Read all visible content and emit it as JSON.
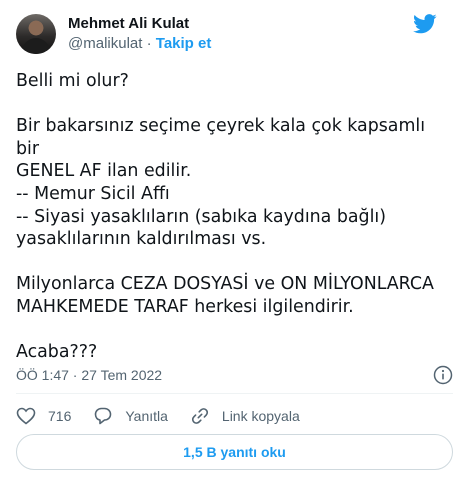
{
  "author": {
    "name": "Mehmet Ali Kulat",
    "handle": "@malikulat",
    "separator": "·",
    "follow_label": "Takip et"
  },
  "tweet": {
    "line1": "Belli mi olur?",
    "para2": "Bir bakarsınız seçime çeyrek kala çok kapsamlı bir\nGENEL AF ilan edilir.\n-- Memur Sicil Affı\n-- Siyasi yasaklıların (sabıka kaydına bağlı)\nyasaklılarının kaldırılması vs.",
    "para3": "Milyonlarca CEZA DOSYASİ ve ON MİLYONLARCA\nMAHKEMEDE TARAF herkesi ilgilendirir.",
    "para4": "Acaba???"
  },
  "meta": {
    "timestamp": "ÖÖ 1:47 · 27 Tem 2022"
  },
  "actions": {
    "likes": "716",
    "reply_label": "Yanıtla",
    "copy_link_label": "Link kopyala"
  },
  "read_replies_label": "1,5 B yanıtı oku",
  "icons": {
    "brand": "twitter-bird-icon",
    "like": "heart-icon",
    "reply": "speech-bubble-icon",
    "link": "link-icon",
    "info": "info-icon"
  },
  "colors": {
    "accent": "#1d9bf0",
    "text": "#0f1419",
    "muted": "#536471",
    "border": "#cfd9de"
  }
}
